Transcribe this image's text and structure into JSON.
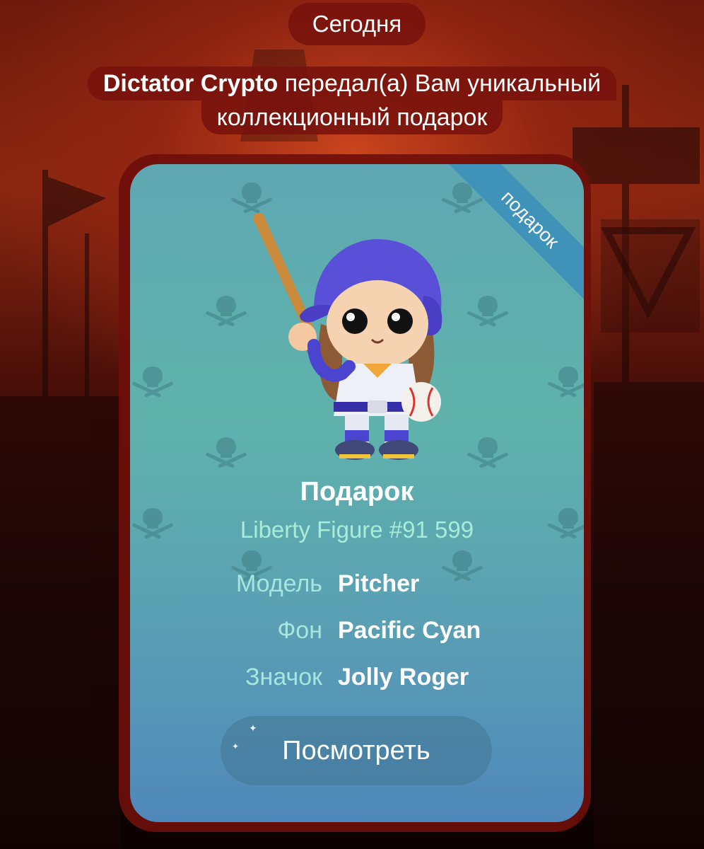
{
  "chat": {
    "date": "Сегодня",
    "service_message": {
      "sender": "Dictator Crypto",
      "text_line1": " передал(а) Вам уникальный",
      "text_line2": "коллекционный подарок"
    }
  },
  "gift": {
    "ribbon": "подарок",
    "title": "Подарок",
    "name": "Liberty Figure #91 599",
    "attributes": [
      {
        "label": "Модель",
        "value": "Pitcher"
      },
      {
        "label": "Фон",
        "value": "Pacific Cyan"
      },
      {
        "label": "Значок",
        "value": "Jolly Roger"
      }
    ],
    "view_button": "Посмотреть",
    "figure_icon": "baseball-pitcher-girl",
    "pattern_icon": "skull-crossbones"
  },
  "colors": {
    "bubble": "#6e0e0a",
    "card_top": "#5fa7b3",
    "card_bottom": "#4f88ba",
    "ribbon": "#3f92b8",
    "subtitle": "#a9ecd6"
  }
}
